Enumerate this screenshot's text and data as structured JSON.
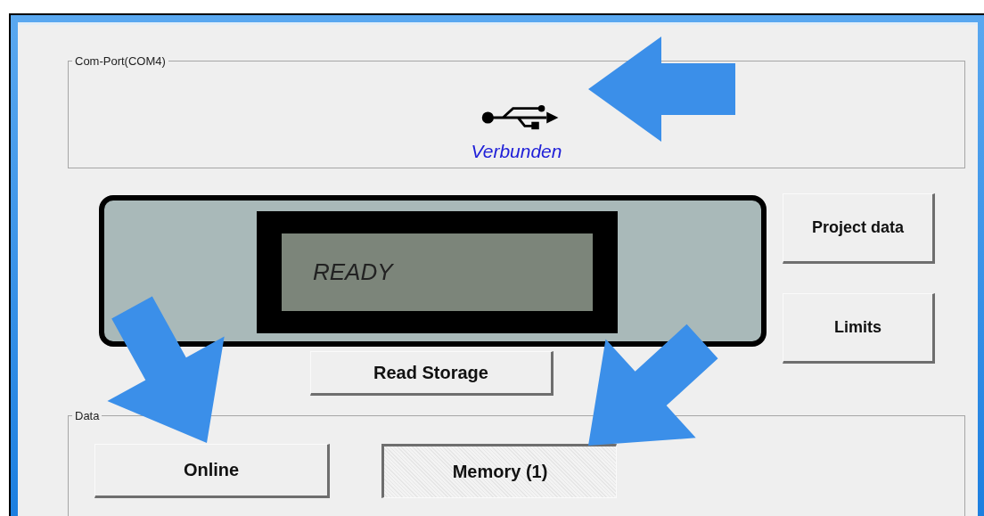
{
  "com_port": {
    "title": "Com-Port(COM4)",
    "status": "Verbunden"
  },
  "display": {
    "text": "READY"
  },
  "side_buttons": [
    {
      "label": "Project data"
    },
    {
      "label": "Limits"
    }
  ],
  "read_button": {
    "label": "Read Storage"
  },
  "data": {
    "title": "Data",
    "modes": [
      {
        "label": "Online",
        "selected": false
      },
      {
        "label": "Memory (1)",
        "selected": true
      }
    ]
  }
}
